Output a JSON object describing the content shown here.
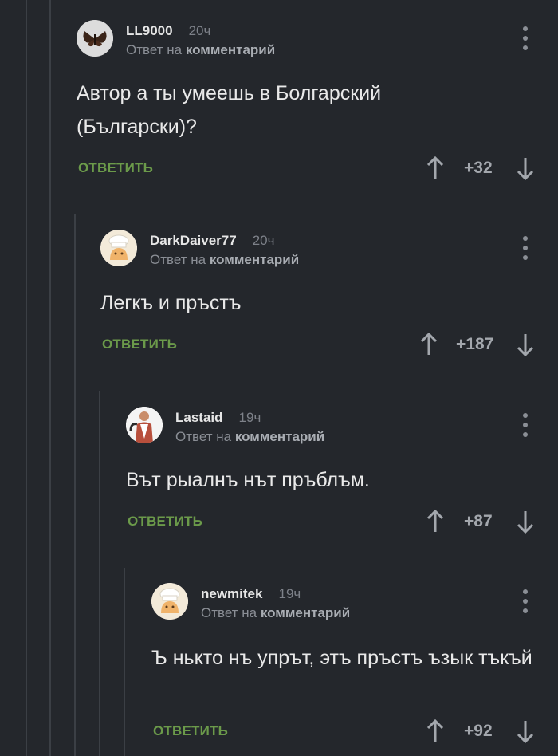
{
  "comments": [
    {
      "author": "LL9000",
      "time": "20ч",
      "reply_prefix": "Ответ на",
      "reply_target": "комментарий",
      "text": "Автор а ты умеешь в Болгарский (Български)?",
      "reply_label": "ОТВЕТИТЬ",
      "score": "+32",
      "avatar": "moth-avatar"
    },
    {
      "author": "DarkDaiver77",
      "time": "20ч",
      "reply_prefix": "Ответ на",
      "reply_target": "комментарий",
      "text": "Легкъ и пръстъ",
      "reply_label": "ОТВЕТИТЬ",
      "score": "+187",
      "avatar": "chef-avatar"
    },
    {
      "author": "Lastaid",
      "time": "19ч",
      "reply_prefix": "Ответ на",
      "reply_target": "комментарий",
      "text": "Вът рыалнъ нът пръблъм.",
      "reply_label": "ОТВЕТИТЬ",
      "score": "+87",
      "avatar": "person-avatar"
    },
    {
      "author": "newmitek",
      "time": "19ч",
      "reply_prefix": "Ответ на",
      "reply_target": "комментарий",
      "text": "Ъ нькто нъ упрът, этъ пръстъ ъзык тъкъй",
      "reply_label": "ОТВЕТИТЬ",
      "score": "+92",
      "avatar": "chef-avatar"
    }
  ],
  "colors": {
    "background": "#24272c",
    "reply_button": "#6b9a4a",
    "thread_line": "#3b3f45"
  }
}
